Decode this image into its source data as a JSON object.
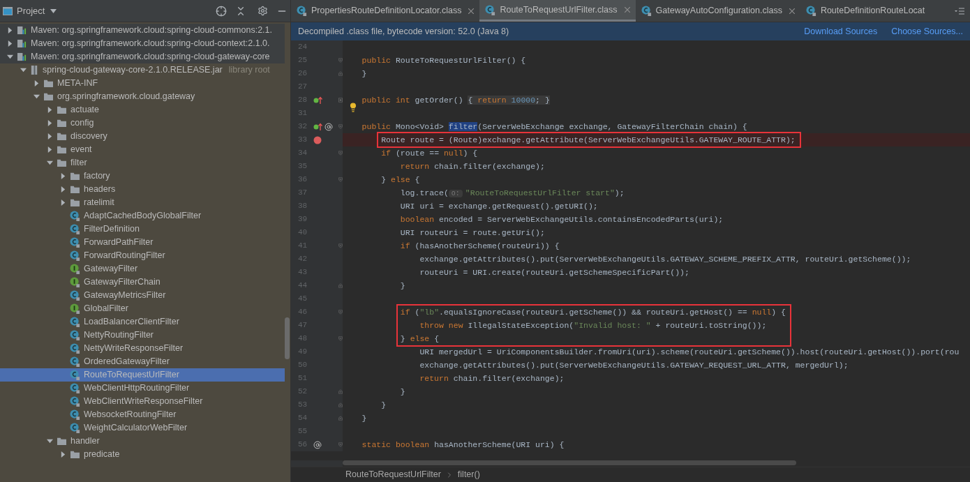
{
  "project_panel": {
    "title": "Project",
    "tree": [
      {
        "label": "Maven: org.springframework.cloud:spring-cloud-commons:2.1.",
        "kind": "maven",
        "expanded": false,
        "selected": false
      },
      {
        "label": "Maven: org.springframework.cloud:spring-cloud-context:2.1.0.",
        "kind": "maven",
        "expanded": false,
        "selected": false
      },
      {
        "label": "Maven: org.springframework.cloud:spring-cloud-gateway-core",
        "kind": "maven",
        "expanded": true,
        "selected": false,
        "children": [
          {
            "label": "spring-cloud-gateway-core-2.1.0.RELEASE.jar",
            "note": "library root",
            "kind": "jar",
            "expanded": true,
            "selected": false,
            "children": [
              {
                "label": "META-INF",
                "kind": "folder",
                "expanded": false,
                "selected": false
              },
              {
                "label": "org.springframework.cloud.gateway",
                "kind": "folder",
                "expanded": true,
                "selected": false,
                "children": [
                  {
                    "label": "actuate",
                    "kind": "folder",
                    "expanded": false,
                    "selected": false
                  },
                  {
                    "label": "config",
                    "kind": "folder",
                    "expanded": false,
                    "selected": false
                  },
                  {
                    "label": "discovery",
                    "kind": "folder",
                    "expanded": false,
                    "selected": false
                  },
                  {
                    "label": "event",
                    "kind": "folder",
                    "expanded": false,
                    "selected": false
                  },
                  {
                    "label": "filter",
                    "kind": "folder",
                    "expanded": true,
                    "selected": false,
                    "children": [
                      {
                        "label": "factory",
                        "kind": "folder",
                        "expanded": false,
                        "selected": false
                      },
                      {
                        "label": "headers",
                        "kind": "folder",
                        "expanded": false,
                        "selected": false
                      },
                      {
                        "label": "ratelimit",
                        "kind": "folder",
                        "expanded": false,
                        "selected": false
                      },
                      {
                        "label": "AdaptCachedBodyGlobalFilter",
                        "kind": "class",
                        "selected": false
                      },
                      {
                        "label": "FilterDefinition",
                        "kind": "class",
                        "selected": false
                      },
                      {
                        "label": "ForwardPathFilter",
                        "kind": "class",
                        "selected": false
                      },
                      {
                        "label": "ForwardRoutingFilter",
                        "kind": "class",
                        "selected": false
                      },
                      {
                        "label": "GatewayFilter",
                        "kind": "interface",
                        "selected": false
                      },
                      {
                        "label": "GatewayFilterChain",
                        "kind": "interface",
                        "selected": false
                      },
                      {
                        "label": "GatewayMetricsFilter",
                        "kind": "class",
                        "selected": false
                      },
                      {
                        "label": "GlobalFilter",
                        "kind": "interface",
                        "selected": false
                      },
                      {
                        "label": "LoadBalancerClientFilter",
                        "kind": "class",
                        "selected": false
                      },
                      {
                        "label": "NettyRoutingFilter",
                        "kind": "class",
                        "selected": false
                      },
                      {
                        "label": "NettyWriteResponseFilter",
                        "kind": "class",
                        "selected": false
                      },
                      {
                        "label": "OrderedGatewayFilter",
                        "kind": "class",
                        "selected": false
                      },
                      {
                        "label": "RouteToRequestUrlFilter",
                        "kind": "class",
                        "selected": true
                      },
                      {
                        "label": "WebClientHttpRoutingFilter",
                        "kind": "class",
                        "selected": false
                      },
                      {
                        "label": "WebClientWriteResponseFilter",
                        "kind": "class",
                        "selected": false
                      },
                      {
                        "label": "WebsocketRoutingFilter",
                        "kind": "class",
                        "selected": false
                      },
                      {
                        "label": "WeightCalculatorWebFilter",
                        "kind": "class",
                        "selected": false
                      }
                    ]
                  },
                  {
                    "label": "handler",
                    "kind": "folder",
                    "expanded": true,
                    "selected": false,
                    "children": [
                      {
                        "label": "predicate",
                        "kind": "folder",
                        "expanded": false,
                        "selected": false
                      }
                    ]
                  }
                ]
              }
            ]
          }
        ]
      }
    ]
  },
  "editor": {
    "tabs": [
      {
        "label": "PropertiesRouteDefinitionLocator.class",
        "selected": false,
        "closable": true
      },
      {
        "label": "RouteToRequestUrlFilter.class",
        "selected": true,
        "closable": true
      },
      {
        "label": "GatewayAutoConfiguration.class",
        "selected": false,
        "closable": true
      },
      {
        "label": "RouteDefinitionRouteLocat",
        "selected": false,
        "closable": false
      }
    ],
    "banner": {
      "message": "Decompiled .class file, bytecode version: 52.0 (Java 8)",
      "links": [
        "Download Sources",
        "Choose Sources..."
      ]
    },
    "lines": [
      {
        "number": "24",
        "boxed": false
      },
      {
        "number": "25",
        "boxed": false,
        "fold": {
          "kind": "start"
        },
        "tokens": [
          {
            "kind": "kw",
            "text": "    public "
          },
          {
            "kind": "plain",
            "text": "RouteToRequestUrlFilter() {"
          }
        ]
      },
      {
        "number": "26",
        "boxed": false,
        "fold": {
          "kind": "end"
        },
        "tokens": [
          {
            "kind": "plain",
            "text": "    }"
          }
        ]
      },
      {
        "number": "27",
        "boxed": false
      },
      {
        "number": "28",
        "boxed": false,
        "fold": {
          "kind": "collapsed"
        },
        "gutter_icons": [
          {
            "kind": "implements"
          }
        ],
        "tokens": [
          {
            "kind": "kw",
            "text": "    public int "
          },
          {
            "kind": "plain",
            "text": "getOrder() "
          },
          {
            "kind": "folded_plain",
            "text": "{ "
          },
          {
            "kind": "folded_kw",
            "text": "return "
          },
          {
            "kind": "folded_num",
            "text": "10000"
          },
          {
            "kind": "folded_plain",
            "text": "; }"
          }
        ]
      },
      {
        "number": "31",
        "boxed": false,
        "gutter_icons": [
          {
            "kind": "bulb"
          }
        ]
      },
      {
        "number": "32",
        "boxed": false,
        "fold": {
          "kind": "start"
        },
        "gutter_icons": [
          {
            "kind": "implements"
          },
          {
            "kind": "annotation"
          }
        ],
        "tokens": [
          {
            "kind": "kw",
            "text": "    public "
          },
          {
            "kind": "plain",
            "text": "Mono<Void> "
          },
          {
            "kind": "selected",
            "text": "filter"
          },
          {
            "kind": "plain",
            "text": "(ServerWebExchange exchange, GatewayFilterChain chain) {"
          }
        ]
      },
      {
        "number": "33",
        "boxed": true,
        "gutter_icons": [
          {
            "kind": "breakpoint"
          }
        ],
        "tokens": [
          {
            "kind": "plain",
            "text": "        Route route = (Route)exchange.getAttribute(ServerWebExchangeUtils.GATEWAY_ROUTE_ATTR);"
          }
        ]
      },
      {
        "number": "34",
        "boxed": false,
        "fold": {
          "kind": "start"
        },
        "tokens": [
          {
            "kind": "kw",
            "text": "        if "
          },
          {
            "kind": "plain",
            "text": "(route == "
          },
          {
            "kind": "kw",
            "text": "null"
          },
          {
            "kind": "plain",
            "text": ") {"
          }
        ]
      },
      {
        "number": "35",
        "boxed": false,
        "tokens": [
          {
            "kind": "kw",
            "text": "            return "
          },
          {
            "kind": "plain",
            "text": "chain.filter(exchange);"
          }
        ]
      },
      {
        "number": "36",
        "boxed": false,
        "fold": {
          "kind": "start"
        },
        "tokens": [
          {
            "kind": "plain",
            "text": "        } "
          },
          {
            "kind": "kw",
            "text": "else "
          },
          {
            "kind": "plain",
            "text": "{"
          }
        ]
      },
      {
        "number": "37",
        "boxed": false,
        "tokens": [
          {
            "kind": "plain",
            "text": "            log.trace("
          },
          {
            "kind": "hint",
            "text": "o:"
          },
          {
            "kind": "str",
            "text": "\"RouteToRequestUrlFilter start\""
          },
          {
            "kind": "plain",
            "text": ");"
          }
        ]
      },
      {
        "number": "38",
        "boxed": false,
        "tokens": [
          {
            "kind": "plain",
            "text": "            URI uri = exchange.getRequest().getURI();"
          }
        ]
      },
      {
        "number": "39",
        "boxed": false,
        "tokens": [
          {
            "kind": "kw",
            "text": "            boolean "
          },
          {
            "kind": "plain",
            "text": "encoded = ServerWebExchangeUtils.containsEncodedParts(uri);"
          }
        ]
      },
      {
        "number": "40",
        "boxed": false,
        "tokens": [
          {
            "kind": "plain",
            "text": "            URI routeUri = route.getUri();"
          }
        ]
      },
      {
        "number": "41",
        "boxed": false,
        "fold": {
          "kind": "start"
        },
        "tokens": [
          {
            "kind": "kw",
            "text": "            if "
          },
          {
            "kind": "plain",
            "text": "(hasAnotherScheme(routeUri)) {"
          }
        ]
      },
      {
        "number": "42",
        "boxed": false,
        "tokens": [
          {
            "kind": "plain",
            "text": "                exchange.getAttributes().put(ServerWebExchangeUtils.GATEWAY_SCHEME_PREFIX_ATTR, routeUri.getScheme());"
          }
        ]
      },
      {
        "number": "43",
        "boxed": false,
        "tokens": [
          {
            "kind": "plain",
            "text": "                routeUri = URI.create(routeUri.getSchemeSpecificPart());"
          }
        ]
      },
      {
        "number": "44",
        "boxed": false,
        "fold": {
          "kind": "end"
        },
        "tokens": [
          {
            "kind": "plain",
            "text": "            }"
          }
        ]
      },
      {
        "number": "45",
        "boxed": false
      },
      {
        "number": "46",
        "boxed": true,
        "fold": {
          "kind": "start"
        },
        "tokens": [
          {
            "kind": "kw",
            "text": "            if "
          },
          {
            "kind": "plain",
            "text": "("
          },
          {
            "kind": "str",
            "text": "\"lb\""
          },
          {
            "kind": "plain",
            "text": ".equalsIgnoreCase(routeUri.getScheme()) && routeUri.getHost() == "
          },
          {
            "kind": "kw",
            "text": "null"
          },
          {
            "kind": "plain",
            "text": ") {"
          }
        ]
      },
      {
        "number": "47",
        "boxed": true,
        "tokens": [
          {
            "kind": "kw",
            "text": "                throw new "
          },
          {
            "kind": "plain",
            "text": "IllegalStateException("
          },
          {
            "kind": "str",
            "text": "\"Invalid host: \""
          },
          {
            "kind": "plain",
            "text": " + routeUri.toString());"
          }
        ]
      },
      {
        "number": "48",
        "boxed": true,
        "fold": {
          "kind": "start"
        },
        "tokens": [
          {
            "kind": "plain",
            "text": "            } "
          },
          {
            "kind": "kw",
            "text": "else "
          },
          {
            "kind": "plain",
            "text": "{"
          }
        ]
      },
      {
        "number": "49",
        "boxed": false,
        "tokens": [
          {
            "kind": "plain",
            "text": "                URI mergedUrl = UriComponentsBuilder.fromUri(uri).scheme(routeUri.getScheme()).host(routeUri.getHost()).port(rou"
          }
        ]
      },
      {
        "number": "50",
        "boxed": false,
        "tokens": [
          {
            "kind": "plain",
            "text": "                exchange.getAttributes().put(ServerWebExchangeUtils.GATEWAY_REQUEST_URL_ATTR, mergedUrl);"
          }
        ]
      },
      {
        "number": "51",
        "boxed": false,
        "tokens": [
          {
            "kind": "kw",
            "text": "                return "
          },
          {
            "kind": "plain",
            "text": "chain.filter(exchange);"
          }
        ]
      },
      {
        "number": "52",
        "boxed": false,
        "fold": {
          "kind": "end"
        },
        "tokens": [
          {
            "kind": "plain",
            "text": "            }"
          }
        ]
      },
      {
        "number": "53",
        "boxed": false,
        "fold": {
          "kind": "end"
        },
        "tokens": [
          {
            "kind": "plain",
            "text": "        }"
          }
        ]
      },
      {
        "number": "54",
        "boxed": false,
        "fold": {
          "kind": "end"
        },
        "tokens": [
          {
            "kind": "plain",
            "text": "    }"
          }
        ]
      },
      {
        "number": "55",
        "boxed": false
      },
      {
        "number": "56",
        "boxed": false,
        "fold": {
          "kind": "start"
        },
        "gutter_icons": [
          {
            "kind": "annotation"
          }
        ],
        "tokens": [
          {
            "kind": "kw",
            "text": "    static boolean "
          },
          {
            "kind": "plain",
            "text": "hasAnotherScheme(URI uri) {"
          }
        ]
      }
    ],
    "breadcrumbs": [
      "RouteToRequestUrlFilter",
      "filter()"
    ]
  }
}
